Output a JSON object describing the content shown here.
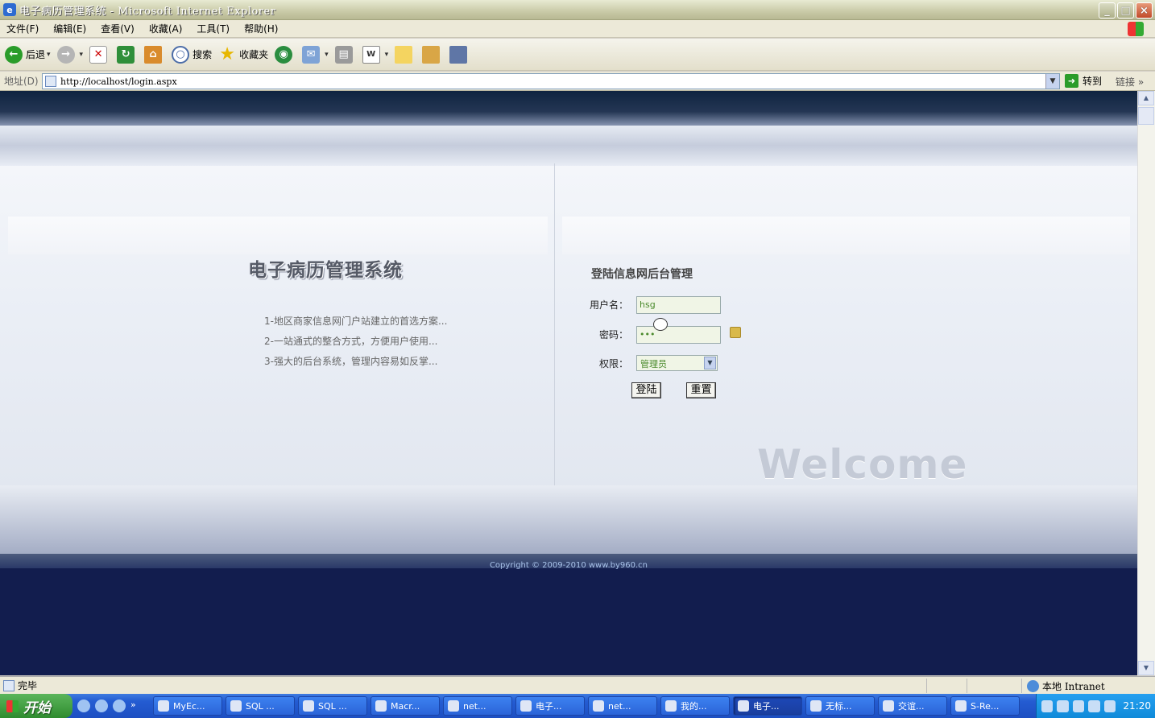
{
  "window": {
    "title": "电子病历管理系统 - Microsoft Internet Explorer",
    "buttons": {
      "minimize": "_",
      "maximize": "□",
      "close": "×"
    }
  },
  "menu": [
    "文件(F)",
    "编辑(E)",
    "查看(V)",
    "收藏(A)",
    "工具(T)",
    "帮助(H)"
  ],
  "toolbar": {
    "back": "后退",
    "search": "搜索",
    "favorites": "收藏夹"
  },
  "address": {
    "label": "地址(D)",
    "url": "http://localhost/login.aspx",
    "go": "转到",
    "links": "链接",
    "chevron": "»"
  },
  "page": {
    "system_title": "电子病历管理系统",
    "features": [
      "1-地区商家信息网门户站建立的首选方案...",
      "2-一站通式的整合方式，方便用户使用...",
      "3-强大的后台系统，管理内容易如反掌..."
    ],
    "login_title": "登陆信息网后台管理",
    "username_label": "用户名：",
    "username_value": "hsg",
    "password_label": "密码：",
    "password_value": "•••",
    "role_label": "权限：",
    "role_value": "管理员",
    "login_button": "登陆",
    "reset_button": "重置",
    "welcome": "Welcome",
    "copyright": "Copyright © 2009-2010 www.by960.cn"
  },
  "status": {
    "text": "完毕",
    "zone": "本地 Intranet"
  },
  "taskbar": {
    "start": "开始",
    "tasks": [
      {
        "label": "MyEc...",
        "active": false
      },
      {
        "label": "SQL ...",
        "active": false
      },
      {
        "label": "SQL ...",
        "active": false
      },
      {
        "label": "Macr...",
        "active": false
      },
      {
        "label": "net...",
        "active": false
      },
      {
        "label": "电子...",
        "active": false
      },
      {
        "label": "net...",
        "active": false
      },
      {
        "label": "我的...",
        "active": false
      },
      {
        "label": "电子...",
        "active": true
      },
      {
        "label": "无标...",
        "active": false
      },
      {
        "label": "交谊...",
        "active": false
      },
      {
        "label": "S-Re...",
        "active": false
      }
    ],
    "clock": "21:20"
  },
  "colors": {
    "header_dark": "#0f2440",
    "footer_navy": "#121d4e",
    "input_bg": "#f0f5e6",
    "input_text": "#4a8a2c",
    "taskbar": "#245cd2"
  }
}
